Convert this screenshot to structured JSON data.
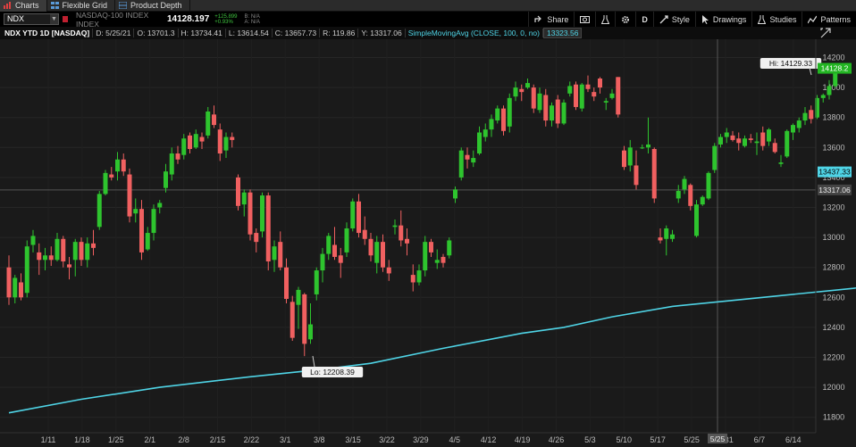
{
  "tabs": [
    {
      "label": "Charts",
      "active": true,
      "icon": "chart-icon"
    },
    {
      "label": "Flexible Grid",
      "active": false,
      "icon": "grid-icon"
    },
    {
      "label": "Product Depth",
      "active": false,
      "icon": "depth-icon"
    }
  ],
  "toolbar": {
    "symbol": "NDX",
    "description": "NASDAQ-100 INDEX INDEX",
    "last": "14128.197",
    "change": "+125.899",
    "change_pct": "+0.93%",
    "bid": "B: N/A",
    "ask": "A: N/A",
    "buttons": [
      {
        "label": "Share",
        "icon": "share-icon"
      },
      {
        "label": "",
        "icon": "screenshot-icon"
      },
      {
        "label": "",
        "icon": "flask-icon"
      },
      {
        "label": "",
        "icon": "gear-icon"
      },
      {
        "label": "D",
        "icon": ""
      },
      {
        "label": "Style",
        "icon": "style-icon"
      },
      {
        "label": "Drawings",
        "icon": "cursor-icon"
      },
      {
        "label": "Studies",
        "icon": "flask-icon"
      },
      {
        "label": "Patterns",
        "icon": "patterns-icon"
      }
    ]
  },
  "infobar": {
    "title": "NDX YTD 1D [NASDAQ]",
    "date": "D: 5/25/21",
    "open": "O: 13701.3",
    "high": "H: 13734.41",
    "low": "L: 13614.54",
    "close": "C: 13657.73",
    "range": "R: 119.86",
    "y": "Y: 13317.06",
    "study": "SimpleMovingAvg (CLOSE, 100, 0, no)",
    "study_value": "13323.56"
  },
  "colors": {
    "up": "#2ec42e",
    "down": "#f06060",
    "sma": "#4fd4e6",
    "grid": "#262626",
    "bg": "#1a1a1a"
  },
  "chart_data": {
    "type": "candlestick",
    "ylim": [
      11700,
      14300
    ],
    "y_ticks": [
      11800,
      12000,
      12200,
      12400,
      12600,
      12800,
      13000,
      13200,
      13400,
      13600,
      13800,
      14000,
      14200
    ],
    "x_ticks": [
      "1/11",
      "1/18",
      "1/25",
      "2/1",
      "2/8",
      "2/15",
      "2/22",
      "3/1",
      "3/8",
      "3/15",
      "3/22",
      "3/29",
      "4/5",
      "4/12",
      "4/19",
      "4/26",
      "5/3",
      "5/10",
      "5/17",
      "5/25",
      "5/31",
      "6/7",
      "6/14"
    ],
    "price_labels": {
      "last": "14128.2",
      "sma": "13437.33",
      "crosshair": "13317.06"
    },
    "hi_label": "Hi: 14129.33",
    "lo_label": "Lo: 12208.39",
    "crosshair_x_label": "5/25",
    "candles": [
      [
        12800,
        12880,
        12550,
        12600
      ],
      [
        12600,
        12750,
        12560,
        12730
      ],
      [
        12700,
        12760,
        12580,
        12600
      ],
      [
        12630,
        12980,
        12600,
        12940
      ],
      [
        12950,
        13050,
        12900,
        13010
      ],
      [
        12900,
        12960,
        12750,
        12850
      ],
      [
        12850,
        12930,
        12780,
        12880
      ],
      [
        12880,
        12940,
        12810,
        12850
      ],
      [
        12850,
        13030,
        12840,
        12990
      ],
      [
        12990,
        13010,
        12800,
        12840
      ],
      [
        12820,
        12870,
        12720,
        12800
      ],
      [
        12850,
        12990,
        12740,
        12970
      ],
      [
        12970,
        13000,
        12810,
        12850
      ],
      [
        12850,
        13000,
        12800,
        12960
      ],
      [
        12960,
        13050,
        12880,
        12930
      ],
      [
        13070,
        13310,
        13050,
        13290
      ],
      [
        13290,
        13450,
        13280,
        13430
      ],
      [
        13420,
        13470,
        13380,
        13400
      ],
      [
        13440,
        13570,
        13380,
        13520
      ],
      [
        13520,
        13560,
        13410,
        13440
      ],
      [
        13420,
        13460,
        13100,
        13140
      ],
      [
        13160,
        13260,
        13100,
        13190
      ],
      [
        13190,
        13250,
        12850,
        12900
      ],
      [
        12920,
        13070,
        12910,
        13030
      ],
      [
        13030,
        13220,
        12980,
        13190
      ],
      [
        13200,
        13250,
        13160,
        13230
      ],
      [
        13330,
        13490,
        13300,
        13440
      ],
      [
        13420,
        13600,
        13380,
        13560
      ],
      [
        13560,
        13610,
        13490,
        13520
      ],
      [
        13550,
        13690,
        13520,
        13660
      ],
      [
        13680,
        13700,
        13560,
        13590
      ],
      [
        13600,
        13720,
        13590,
        13690
      ],
      [
        13670,
        13700,
        13590,
        13640
      ],
      [
        13680,
        13870,
        13660,
        13840
      ],
      [
        13820,
        13880,
        13730,
        13750
      ],
      [
        13720,
        13760,
        13510,
        13560
      ],
      [
        13580,
        13700,
        13530,
        13670
      ],
      [
        13670,
        13700,
        13600,
        13650
      ],
      [
        13400,
        13420,
        13180,
        13210
      ],
      [
        13220,
        13320,
        13140,
        13300
      ],
      [
        13300,
        13320,
        12980,
        13020
      ],
      [
        13030,
        13060,
        12900,
        12970
      ],
      [
        13040,
        13300,
        13000,
        13280
      ],
      [
        13280,
        13300,
        12780,
        12840
      ],
      [
        12850,
        12980,
        12770,
        12940
      ],
      [
        12970,
        13040,
        12780,
        12800
      ],
      [
        12800,
        12860,
        12560,
        12590
      ],
      [
        12570,
        12610,
        12310,
        12330
      ],
      [
        12550,
        12670,
        12390,
        12650
      ],
      [
        12620,
        12630,
        12208,
        12290
      ],
      [
        12320,
        12560,
        12290,
        12420
      ],
      [
        12620,
        12800,
        12580,
        12780
      ],
      [
        12780,
        12930,
        12700,
        12890
      ],
      [
        12890,
        13030,
        12850,
        13010
      ],
      [
        12950,
        13070,
        12850,
        12870
      ],
      [
        12880,
        12930,
        12730,
        12830
      ],
      [
        12900,
        13100,
        12870,
        13060
      ],
      [
        13060,
        13260,
        13040,
        13240
      ],
      [
        13240,
        13290,
        13000,
        13030
      ],
      [
        13050,
        13140,
        12950,
        12990
      ],
      [
        12990,
        13030,
        12840,
        12880
      ],
      [
        12830,
        13010,
        12760,
        12970
      ],
      [
        12970,
        13020,
        12770,
        12800
      ],
      [
        12800,
        12850,
        12710,
        12760
      ],
      [
        13070,
        13120,
        13020,
        13080
      ],
      [
        13080,
        13180,
        12940,
        12980
      ],
      [
        12990,
        13060,
        12880,
        12960
      ],
      [
        12750,
        12820,
        12640,
        12700
      ],
      [
        12700,
        12820,
        12680,
        12780
      ],
      [
        12780,
        13010,
        12740,
        12970
      ],
      [
        12970,
        12990,
        12870,
        12900
      ],
      [
        12830,
        12920,
        12790,
        12850
      ],
      [
        12870,
        12890,
        12800,
        12830
      ],
      [
        12880,
        13000,
        12860,
        12980
      ],
      [
        13260,
        13340,
        13230,
        13320
      ],
      [
        13400,
        13600,
        13380,
        13580
      ],
      [
        13550,
        13600,
        13460,
        13520
      ],
      [
        13500,
        13580,
        13470,
        13530
      ],
      [
        13560,
        13740,
        13550,
        13700
      ],
      [
        13670,
        13760,
        13640,
        13720
      ],
      [
        13720,
        13820,
        13670,
        13790
      ],
      [
        13780,
        13880,
        13760,
        13860
      ],
      [
        13860,
        13880,
        13680,
        13710
      ],
      [
        13740,
        13960,
        13700,
        13930
      ],
      [
        13940,
        14040,
        13910,
        14000
      ],
      [
        13990,
        14020,
        13910,
        13970
      ],
      [
        14000,
        14060,
        13990,
        14030
      ],
      [
        14000,
        14020,
        13830,
        13860
      ],
      [
        13850,
        14000,
        13830,
        13960
      ],
      [
        13950,
        13990,
        13740,
        13780
      ],
      [
        13780,
        13900,
        13740,
        13880
      ],
      [
        13920,
        13950,
        13730,
        13760
      ],
      [
        13760,
        13920,
        13750,
        13900
      ],
      [
        13960,
        14040,
        13940,
        14010
      ],
      [
        14020,
        14040,
        13850,
        13870
      ],
      [
        13860,
        14030,
        13840,
        14020
      ],
      [
        14020,
        14080,
        13970,
        13990
      ],
      [
        13970,
        14000,
        13910,
        13940
      ],
      [
        14060,
        14070,
        13960,
        14000
      ],
      [
        13900,
        13930,
        13850,
        13910
      ],
      [
        13930,
        13990,
        13920,
        13960
      ],
      [
        14070,
        14070,
        13800,
        13820
      ],
      [
        13580,
        13610,
        13450,
        13470
      ],
      [
        13480,
        13650,
        13440,
        13600
      ],
      [
        13480,
        13580,
        13320,
        13350
      ],
      [
        13600,
        13620,
        13590,
        13600
      ],
      [
        13600,
        13800,
        13560,
        13620
      ],
      [
        13590,
        13600,
        13230,
        13260
      ],
      [
        13000,
        13060,
        12960,
        12980
      ],
      [
        12990,
        13080,
        12880,
        13060
      ],
      [
        12990,
        13050,
        12970,
        13020
      ],
      [
        13260,
        13350,
        13230,
        13310
      ],
      [
        13320,
        13410,
        13290,
        13390
      ],
      [
        13350,
        13360,
        13180,
        13210
      ],
      [
        13010,
        13250,
        13000,
        13220
      ],
      [
        13220,
        13280,
        13210,
        13270
      ],
      [
        13260,
        13440,
        13250,
        13430
      ],
      [
        13450,
        13630,
        13430,
        13610
      ],
      [
        13620,
        13690,
        13600,
        13670
      ],
      [
        13670,
        13730,
        13630,
        13700
      ],
      [
        13680,
        13710,
        13640,
        13650
      ],
      [
        13660,
        13700,
        13580,
        13630
      ],
      [
        13610,
        13680,
        13600,
        13660
      ],
      [
        13660,
        13690,
        13630,
        13650
      ],
      [
        13630,
        13700,
        13550,
        13640
      ],
      [
        13700,
        13740,
        13580,
        13610
      ],
      [
        13640,
        13730,
        13610,
        13720
      ],
      [
        13630,
        13660,
        13560,
        13570
      ],
      [
        13490,
        13550,
        13470,
        13500
      ],
      [
        13540,
        13720,
        13530,
        13710
      ],
      [
        13700,
        13760,
        13650,
        13750
      ],
      [
        13730,
        13800,
        13700,
        13780
      ],
      [
        13780,
        13870,
        13750,
        13830
      ],
      [
        13850,
        13880,
        13760,
        13790
      ],
      [
        13800,
        13950,
        13790,
        13930
      ],
      [
        13930,
        13960,
        13900,
        13950
      ],
      [
        13950,
        14050,
        13920,
        14010
      ],
      [
        14010,
        14129,
        14000,
        14128
      ]
    ],
    "sma": [
      [
        0,
        11830
      ],
      [
        12,
        11920
      ],
      [
        25,
        12000
      ],
      [
        40,
        12070
      ],
      [
        52,
        12120
      ],
      [
        60,
        12160
      ],
      [
        72,
        12260
      ],
      [
        85,
        12360
      ],
      [
        92,
        12400
      ],
      [
        100,
        12470
      ],
      [
        110,
        12540
      ],
      [
        120,
        12580
      ],
      [
        130,
        12620
      ],
      [
        140,
        12660
      ],
      [
        150,
        12720
      ],
      [
        160,
        12790
      ],
      [
        170,
        12860
      ],
      [
        180,
        12960
      ],
      [
        190,
        13050
      ],
      [
        200,
        13130
      ],
      [
        210,
        13200
      ],
      [
        215,
        13240
      ],
      [
        225,
        13280
      ],
      [
        235,
        13320
      ],
      [
        245,
        13370
      ],
      [
        255,
        13420
      ],
      [
        263,
        13437
      ]
    ]
  }
}
